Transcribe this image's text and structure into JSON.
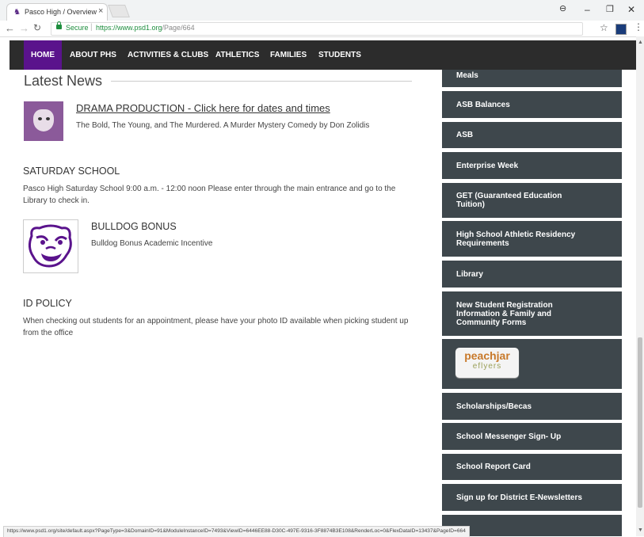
{
  "browser": {
    "tab_title": "Pasco High / Overview",
    "tab_close": "×",
    "secure_label": "Secure",
    "url_base": "https://www.psd1.org",
    "url_path": "/Page/664",
    "status_url": "https://www.psd1.org/site/default.aspx?PageType=3&DomainID=91&ModuleInstanceID=7493&ViewID=6446EE88-D30C-497E-9316-3F8874B3E108&RenderLoc=0&FlexDataID=13437&PageID=664"
  },
  "nav": {
    "items": [
      "HOME",
      "ABOUT PHS",
      "ACTIVITIES & CLUBS",
      "ATHLETICS",
      "FAMILIES",
      "STUDENTS"
    ],
    "active": "HOME"
  },
  "main": {
    "heading": "Latest News",
    "news": [
      {
        "title": "DRAMA PRODUCTION - Click here for dates and times",
        "desc": "The Bold, The Young, and The Murdered. A Murder Mystery Comedy by Don Zolidis"
      },
      {
        "title": "SATURDAY SCHOOL",
        "desc": "Pasco High Saturday School 9:00 a.m. - 12:00 noon Please enter through the main entrance and go to the Library to check in."
      },
      {
        "title": "BULLDOG BONUS",
        "desc": "Bulldog Bonus Academic Incentive"
      },
      {
        "title": "ID POLICY",
        "desc": "When checking out students for an appointment, please have your photo ID available when picking student up from the office"
      }
    ]
  },
  "sidebar": {
    "items": [
      "Meals",
      "ASB Balances",
      "ASB",
      "Enterprise Week",
      "GET (Guaranteed Education Tuition)",
      "High School Athletic Residency Requirements",
      "Library",
      "New Student Registration Information & Family and Community Forms",
      "Scholarships/Becas",
      "School Messenger Sign- Up",
      "School Report Card",
      "Sign up for District E-Newsletters"
    ],
    "peachjar": {
      "line1": "peachjar",
      "line2": "eflyers"
    }
  },
  "colors": {
    "nav_bg": "#2c2c2c",
    "nav_active": "#5a138c",
    "sidebar_btn": "#3e474c"
  }
}
